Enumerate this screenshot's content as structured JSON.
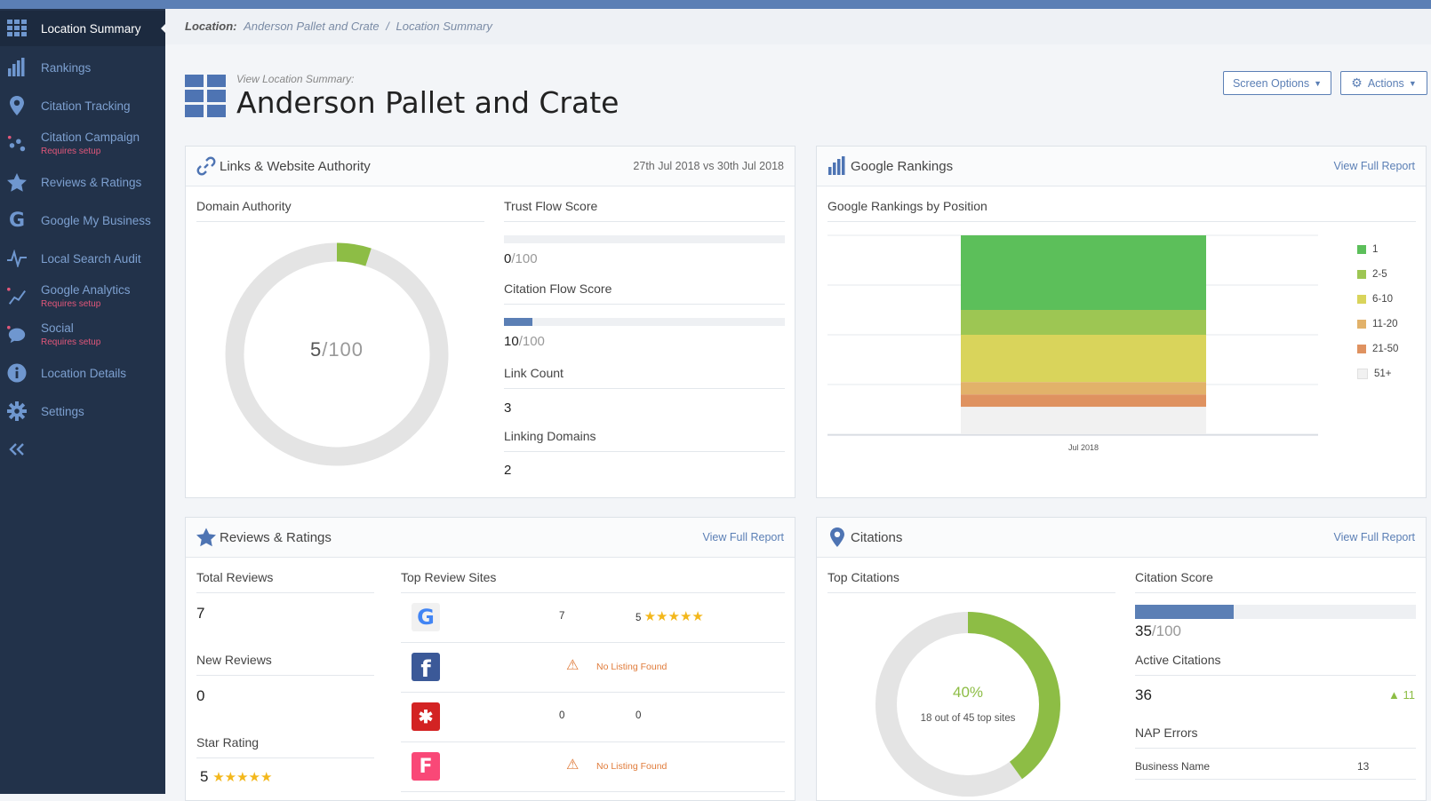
{
  "sidebar": {
    "items": [
      {
        "label": "Location Summary",
        "sub": "",
        "icon": "grid-icon"
      },
      {
        "label": "Rankings",
        "sub": "",
        "icon": "bar-chart-icon"
      },
      {
        "label": "Citation Tracking",
        "sub": "",
        "icon": "map-pin-icon"
      },
      {
        "label": "Citation Campaign",
        "sub": "Requires setup",
        "icon": "campaign-icon"
      },
      {
        "label": "Reviews & Ratings",
        "sub": "",
        "icon": "star-icon"
      },
      {
        "label": "Google My Business",
        "sub": "",
        "icon": "google-icon"
      },
      {
        "label": "Local Search Audit",
        "sub": "",
        "icon": "pulse-icon"
      },
      {
        "label": "Google Analytics",
        "sub": "Requires setup",
        "icon": "line-chart-icon"
      },
      {
        "label": "Social",
        "sub": "Requires setup",
        "icon": "speech-bubble-icon"
      },
      {
        "label": "Location Details",
        "sub": "",
        "icon": "info-icon"
      },
      {
        "label": "Settings",
        "sub": "",
        "icon": "gear-icon"
      }
    ],
    "collapse_icon": "double-chevron-left-icon"
  },
  "breadcrumb": {
    "prefix": "Location:",
    "location": "Anderson Pallet and Crate",
    "separator": "/",
    "page": "Location Summary"
  },
  "header": {
    "view_label": "View Location Summary:",
    "title": "Anderson Pallet and Crate",
    "screen_options": "Screen Options",
    "actions": "Actions"
  },
  "links_panel": {
    "title": "Links & Website Authority",
    "date_range": "27th Jul 2018 vs 30th Jul 2018",
    "domain_authority_label": "Domain Authority",
    "domain_authority_value": "5",
    "domain_authority_max": "/100",
    "domain_authority_fraction": 0.05,
    "trust_flow_label": "Trust Flow Score",
    "trust_flow_value": "0",
    "trust_flow_max": "/100",
    "trust_flow_fraction": 0.0,
    "citation_flow_label": "Citation Flow Score",
    "citation_flow_value": "10",
    "citation_flow_max": "/100",
    "citation_flow_fraction": 0.1,
    "link_count_label": "Link Count",
    "link_count_value": "3",
    "linking_domains_label": "Linking Domains",
    "linking_domains_value": "2"
  },
  "rankings_panel": {
    "title": "Google Rankings",
    "view_full": "View Full Report",
    "chart_title": "Google Rankings by Position"
  },
  "chart_data": {
    "type": "bar",
    "stacked": true,
    "categories": [
      "Jul 2018"
    ],
    "series": [
      {
        "name": "1",
        "values": [
          30
        ],
        "color": "#5cbf5a"
      },
      {
        "name": "2-5",
        "values": [
          10
        ],
        "color": "#9dc653"
      },
      {
        "name": "6-10",
        "values": [
          19
        ],
        "color": "#d9d45b"
      },
      {
        "name": "11-20",
        "values": [
          5
        ],
        "color": "#e2b26a"
      },
      {
        "name": "21-50",
        "values": [
          5
        ],
        "color": "#df9260"
      },
      {
        "name": "51+",
        "values": [
          11
        ],
        "color": "#f1f1f1"
      }
    ],
    "title": "Google Rankings by Position",
    "xlabel": "",
    "ylabel": "",
    "grid": true,
    "legend": "right"
  },
  "reviews_panel": {
    "title": "Reviews & Ratings",
    "view_full": "View Full Report",
    "total_reviews_label": "Total Reviews",
    "total_reviews_value": "7",
    "new_reviews_label": "New Reviews",
    "new_reviews_value": "0",
    "star_rating_label": "Star Rating",
    "star_rating_value": "5",
    "top_sites_label": "Top Review Sites",
    "sites": [
      {
        "icon": "google-logo-icon",
        "count": "7",
        "rating": "5",
        "stars": 5,
        "status": ""
      },
      {
        "icon": "facebook-logo-icon",
        "count": "",
        "rating": "",
        "stars": 0,
        "status": "No Listing Found"
      },
      {
        "icon": "yelp-logo-icon",
        "count": "0",
        "rating": "0",
        "stars": 0,
        "status": ""
      },
      {
        "icon": "foursquare-logo-icon",
        "count": "",
        "rating": "",
        "stars": 0,
        "status": "No Listing Found"
      }
    ]
  },
  "citations_panel": {
    "title": "Citations",
    "view_full": "View Full Report",
    "top_citations_label": "Top Citations",
    "top_percent": "40%",
    "top_fraction": 0.4,
    "top_detail": "18 out of 45 top sites",
    "score_label": "Citation Score",
    "score_value": "35",
    "score_max": "/100",
    "score_fraction": 0.35,
    "active_label": "Active Citations",
    "active_value": "36",
    "active_change": "11",
    "nap_label": "NAP Errors",
    "nap_rows": [
      {
        "name": "Business Name",
        "value": "13"
      }
    ]
  },
  "colors": {
    "accent": "#5b7fb5",
    "sidebar": "#22324a",
    "green": "#8dbd45",
    "warning": "#e07b3a"
  }
}
